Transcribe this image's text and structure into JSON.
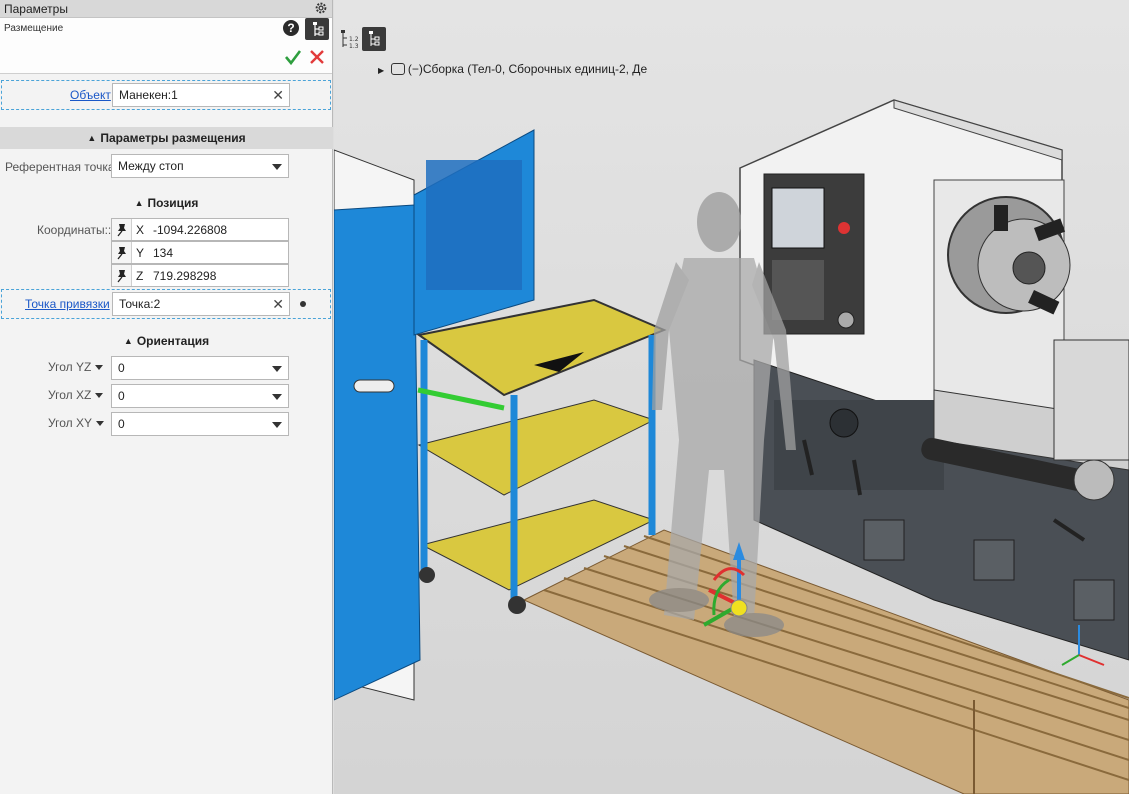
{
  "panel": {
    "title": "Параметры",
    "subtitle": "Размещение",
    "help_label": "?",
    "object": {
      "label": "Объект",
      "value": "Манекен:1"
    },
    "placement_section": "Параметры размещения",
    "reference_point": {
      "label": "Референтная точка:",
      "value": "Между стоп"
    },
    "position_section": "Позиция",
    "coordinates": {
      "label": "Координаты::",
      "rows": [
        {
          "axis": "X",
          "value": "-1094.226808"
        },
        {
          "axis": "Y",
          "value": "134"
        },
        {
          "axis": "Z",
          "value": "719.298298"
        }
      ]
    },
    "snap_point": {
      "label": "Точка привязки",
      "value": "Точка:2"
    },
    "orientation_section": "Ориентация",
    "angles": [
      {
        "label": "Угол YZ",
        "value": "0"
      },
      {
        "label": "Угол XZ",
        "value": "0"
      },
      {
        "label": "Угол XY",
        "value": "0"
      }
    ]
  },
  "viewport": {
    "breadcrumb": "Сборка (Тел-0, Сборочных единиц-2, Де"
  },
  "colors": {
    "accent_link": "#1a57c7",
    "ok": "#2e9e3e",
    "cancel": "#e23a3a",
    "dashed_border": "#4aa3d8"
  }
}
